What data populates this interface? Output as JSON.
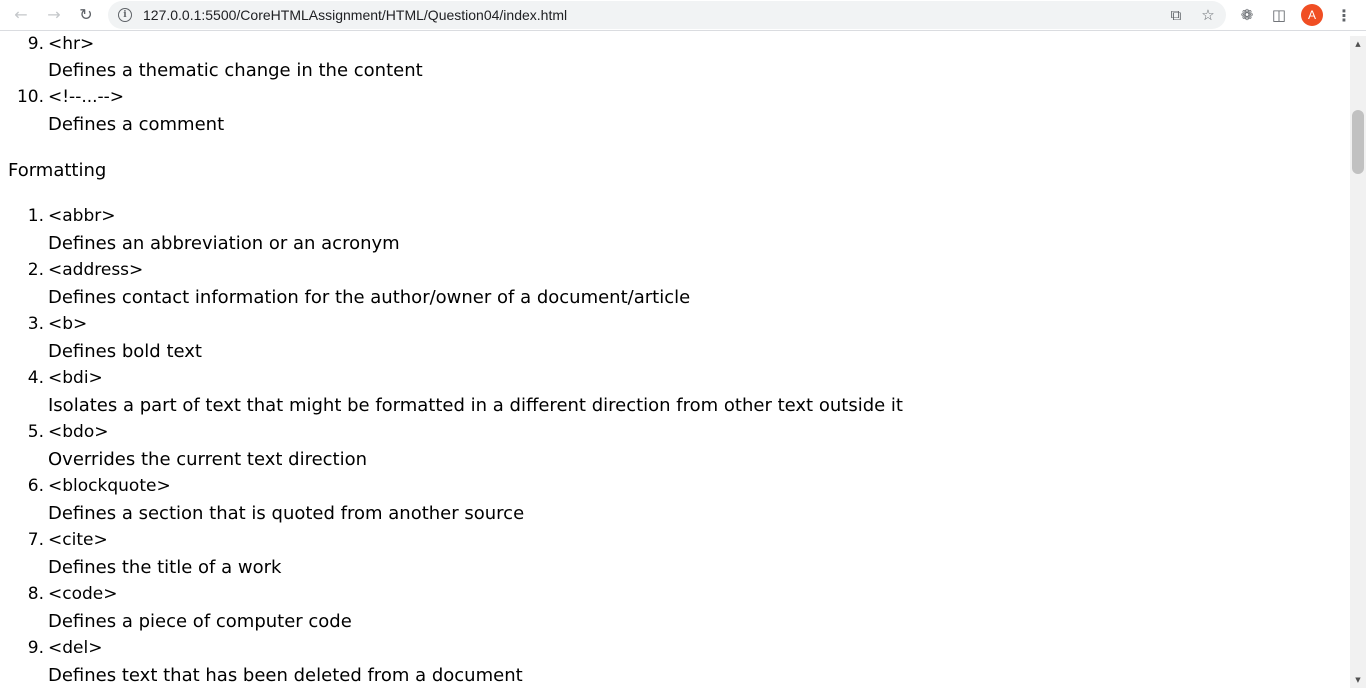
{
  "browser": {
    "url": "127.0.0.1:5500/CoreHTMLAssignment/HTML/Question04/index.html",
    "profile_initial": "A",
    "accent_color": "#f04e23"
  },
  "prev_list": [
    {
      "num": "9.",
      "tag": "<hr>",
      "desc": "Defines a thematic change in the content"
    },
    {
      "num": "10.",
      "tag": "<!--...-->",
      "desc": "Defines a comment"
    }
  ],
  "formatting": {
    "heading": "Formatting",
    "items": [
      {
        "num": "1.",
        "tag": "<abbr>",
        "desc": "Defines an abbreviation or an acronym"
      },
      {
        "num": "2.",
        "tag": "<address>",
        "desc": "Defines contact information for the author/owner of a document/article"
      },
      {
        "num": "3.",
        "tag": "<b>",
        "desc": "Defines bold text"
      },
      {
        "num": "4.",
        "tag": "<bdi>",
        "desc": "Isolates a part of text that might be formatted in a different direction from other text outside it"
      },
      {
        "num": "5.",
        "tag": "<bdo>",
        "desc": "Overrides the current text direction"
      },
      {
        "num": "6.",
        "tag": "<blockquote>",
        "desc": "Defines a section that is quoted from another source"
      },
      {
        "num": "7.",
        "tag": "<cite>",
        "desc": "Defines the title of a work"
      },
      {
        "num": "8.",
        "tag": "<code>",
        "desc": "Defines a piece of computer code"
      },
      {
        "num": "9.",
        "tag": "<del>",
        "desc": "Defines text that has been deleted from a document"
      }
    ]
  }
}
